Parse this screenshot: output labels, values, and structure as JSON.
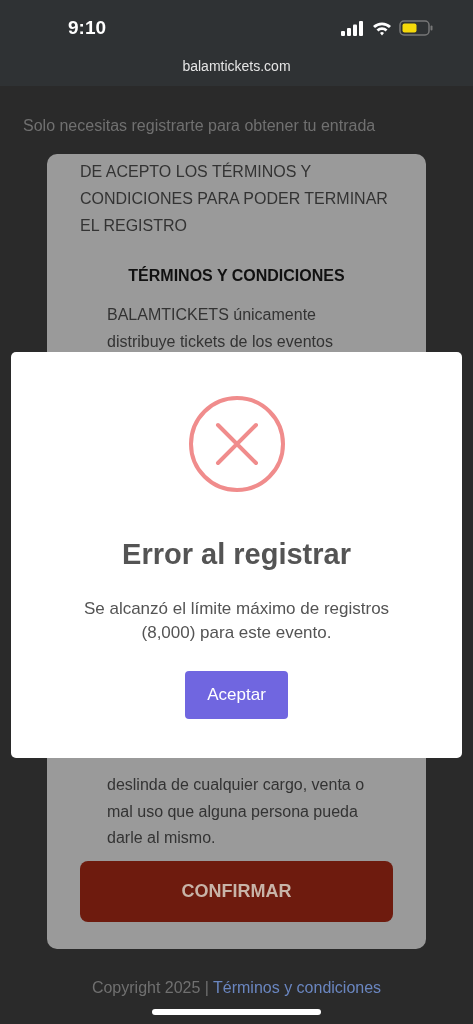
{
  "status_bar": {
    "time": "9:10"
  },
  "address_bar": {
    "url": "balamtickets.com"
  },
  "page": {
    "intro": "Solo necesitas registrarte para obtener tu entrada",
    "card": {
      "notice": "DE ACEPTO LOS TÉRMINOS Y CONDICIONES PARA PODER TERMINAR EL REGISTRO",
      "terms_title": "TÉRMINOS Y CONDICIONES",
      "terms_start": "BALAMTICKETS únicamente distribuye tickets de los eventos",
      "terms_end": "deslinda de cualquier cargo, venta o mal uso que alguna persona pueda darle al mismo.",
      "button": "CONFIRMAR"
    },
    "footer": {
      "copyright": "Copyright 2025 |",
      "link": "Términos y condiciones"
    }
  },
  "dialog": {
    "kind": "error",
    "title": "Error al registrar",
    "message": "Se alcanzó el límite máximo de registros (8,000) para este evento.",
    "button": "Aceptar"
  }
}
